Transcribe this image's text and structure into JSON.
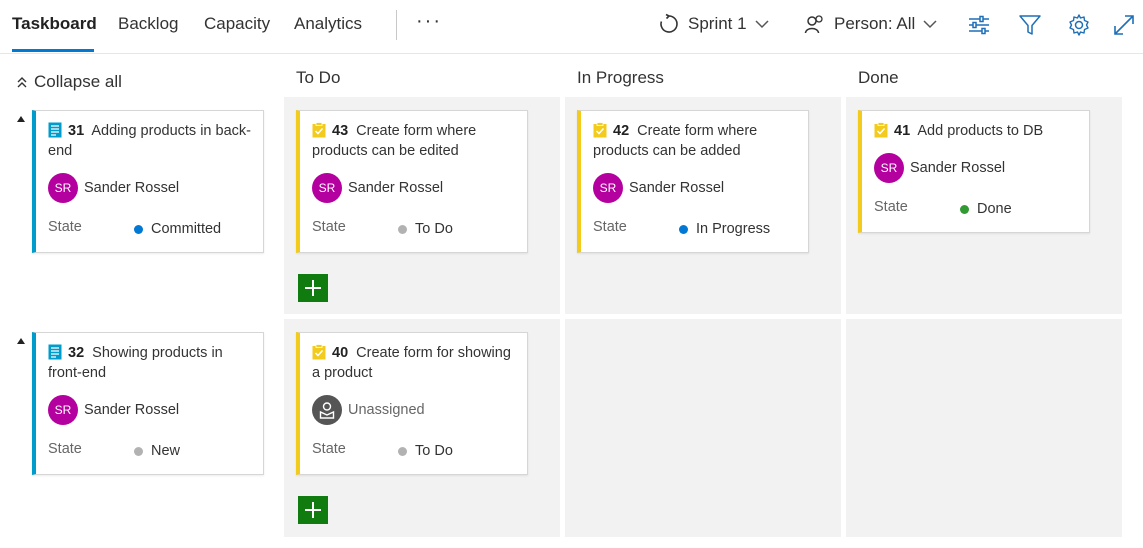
{
  "nav": {
    "tabs": [
      {
        "label": "Taskboard",
        "active": true
      },
      {
        "label": "Backlog"
      },
      {
        "label": "Capacity"
      },
      {
        "label": "Analytics"
      }
    ],
    "more": "···",
    "sprint": "Sprint 1",
    "person": "Person: All"
  },
  "board": {
    "collapse_label": "Collapse all",
    "columns": [
      "To Do",
      "In Progress",
      "Done"
    ],
    "state_label": "State",
    "state_colors": {
      "Committed": "#0078d4",
      "To Do": "#b2b2b2",
      "In Progress": "#0078d4",
      "Done": "#339933",
      "New": "#b2b2b2"
    },
    "rows": [
      {
        "pbi": {
          "id": "31",
          "title": "Adding products in back-end",
          "assignee": "Sander Rossel",
          "initials": "SR",
          "state": "Committed"
        },
        "todo": {
          "id": "43",
          "title": "Create form where products can be edited",
          "assignee": "Sander Rossel",
          "initials": "SR",
          "state": "To Do"
        },
        "inprogress": {
          "id": "42",
          "title": "Create form where products can be added",
          "assignee": "Sander Rossel",
          "initials": "SR",
          "state": "In Progress"
        },
        "done": {
          "id": "41",
          "title": "Add products to DB",
          "assignee": "Sander Rossel",
          "initials": "SR",
          "state": "Done"
        }
      },
      {
        "pbi": {
          "id": "32",
          "title": "Showing products in front-end",
          "assignee": "Sander Rossel",
          "initials": "SR",
          "state": "New"
        },
        "todo": {
          "id": "40",
          "title": "Create form for showing a product",
          "assignee": "Unassigned",
          "state": "To Do"
        }
      }
    ]
  },
  "colors": {
    "accent": "#0078d4",
    "pbi_bar": "#009ccc",
    "task_bar": "#f2cb1d",
    "avatar": "#b4009e",
    "add_button": "#107c10"
  }
}
